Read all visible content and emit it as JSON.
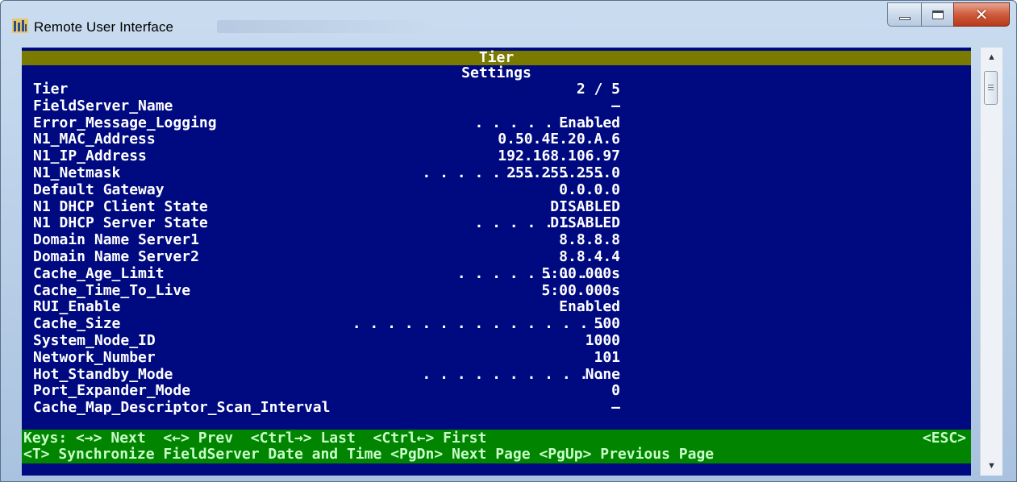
{
  "window": {
    "title": "Remote User Interface",
    "icon": "building-icon"
  },
  "screen": {
    "header": "Tier",
    "subtitle": "Settings",
    "rows": [
      {
        "label": "Tier",
        "value": "2 / 5",
        "dots": ""
      },
      {
        "label": "FieldServer_Name",
        "value": "—",
        "dots": ""
      },
      {
        "label": "Error_Message_Logging",
        "value": "Enabled",
        "dots": ". . . . . . . ."
      },
      {
        "label": "N1_MAC_Address",
        "value": "0.50.4E.20.A.6",
        "dots": ""
      },
      {
        "label": "N1_IP_Address",
        "value": "192.168.106.97",
        "dots": ""
      },
      {
        "label": "N1_Netmask",
        "value": "255.255.255.0",
        "dots": ". . . . . . . . . . ."
      },
      {
        "label": "Default Gateway",
        "value": "0.0.0.0",
        "dots": ""
      },
      {
        "label": "N1 DHCP Client State",
        "value": "DISABLED",
        "dots": ""
      },
      {
        "label": "N1 DHCP Server State",
        "value": "DISABLED",
        "dots": ". . . . . . . ."
      },
      {
        "label": "Domain Name Server1",
        "value": "8.8.8.8",
        "dots": ""
      },
      {
        "label": "Domain Name Server2",
        "value": "8.8.4.4",
        "dots": ""
      },
      {
        "label": "Cache_Age_Limit",
        "value": "5:00.000s",
        "dots": ". . . . . . . . ."
      },
      {
        "label": "Cache_Time_To_Live",
        "value": "5:00.000s",
        "dots": ""
      },
      {
        "label": "RUI_Enable",
        "value": "Enabled",
        "dots": ""
      },
      {
        "label": "Cache_Size",
        "value": "500",
        "dots": ". . . . . . . . . . . . . . ."
      },
      {
        "label": "System_Node_ID",
        "value": "1000",
        "dots": ""
      },
      {
        "label": "Network_Number",
        "value": "101",
        "dots": ""
      },
      {
        "label": "Hot_Standby_Mode",
        "value": "None",
        "dots": ". . . . . . . . . . ."
      },
      {
        "label": "Port_Expander_Mode",
        "value": "0",
        "dots": ""
      },
      {
        "label": "Cache_Map_Descriptor_Scan_Interval",
        "value": "—",
        "dots": ""
      }
    ],
    "keys": {
      "line1": "Keys: <→> Next  <←> Prev  <Ctrl→> Last  <Ctrl←> First",
      "esc": "<ESC>",
      "line2": "<T> Synchronize FieldServer Date and Time <PgDn> Next Page <PgUp> Previous Page"
    }
  },
  "colors": {
    "console_bg": "#000a80",
    "header_bg": "#7a7a00",
    "keys_bg": "#018400"
  }
}
